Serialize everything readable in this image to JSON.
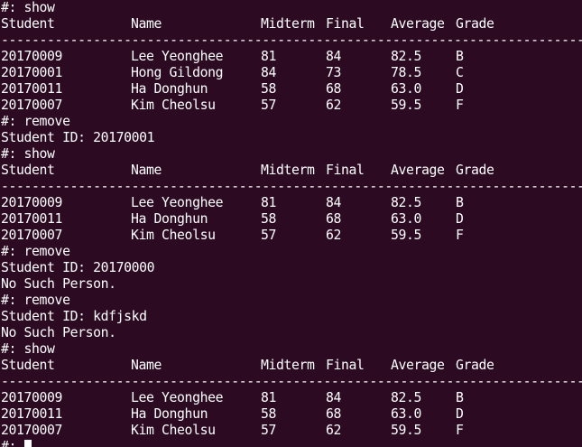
{
  "terminal": {
    "prompt": "#:",
    "cursor_prompt": "#: ",
    "rule": "-----------------------------------------------------------------------------",
    "headers": [
      "Student",
      "Name",
      "Midterm",
      "Final",
      "Average",
      "Grade"
    ],
    "blocks": [
      {
        "type": "command",
        "text": "#: show"
      },
      {
        "type": "table",
        "rows": [
          [
            "20170009",
            "Lee Yeonghee",
            "81",
            "84",
            "82.5",
            "B"
          ],
          [
            "20170001",
            "Hong Gildong",
            "84",
            "73",
            "78.5",
            "C"
          ],
          [
            "20170011",
            "Ha Donghun",
            "58",
            "68",
            "63.0",
            "D"
          ],
          [
            "20170007",
            "Kim Cheolsu",
            "57",
            "62",
            "59.5",
            "F"
          ]
        ]
      },
      {
        "type": "command",
        "text": "#: remove"
      },
      {
        "type": "output",
        "text": "Student ID: 20170001"
      },
      {
        "type": "command",
        "text": "#: show"
      },
      {
        "type": "table",
        "rows": [
          [
            "20170009",
            "Lee Yeonghee",
            "81",
            "84",
            "82.5",
            "B"
          ],
          [
            "20170011",
            "Ha Donghun",
            "58",
            "68",
            "63.0",
            "D"
          ],
          [
            "20170007",
            "Kim Cheolsu",
            "57",
            "62",
            "59.5",
            "F"
          ]
        ]
      },
      {
        "type": "command",
        "text": "#: remove"
      },
      {
        "type": "output",
        "text": "Student ID: 20170000"
      },
      {
        "type": "output",
        "text": "No Such Person."
      },
      {
        "type": "command",
        "text": "#: remove"
      },
      {
        "type": "output",
        "text": "Student ID: kdfjskd"
      },
      {
        "type": "output",
        "text": "No Such Person."
      },
      {
        "type": "command",
        "text": "#: show"
      },
      {
        "type": "table",
        "rows": [
          [
            "20170009",
            "Lee Yeonghee",
            "81",
            "84",
            "82.5",
            "B"
          ],
          [
            "20170011",
            "Ha Donghun",
            "58",
            "68",
            "63.0",
            "D"
          ],
          [
            "20170007",
            "Kim Cheolsu",
            "57",
            "62",
            "59.5",
            "F"
          ]
        ]
      }
    ]
  },
  "colors": {
    "background": "#2c0a22",
    "foreground": "#ffffff"
  }
}
